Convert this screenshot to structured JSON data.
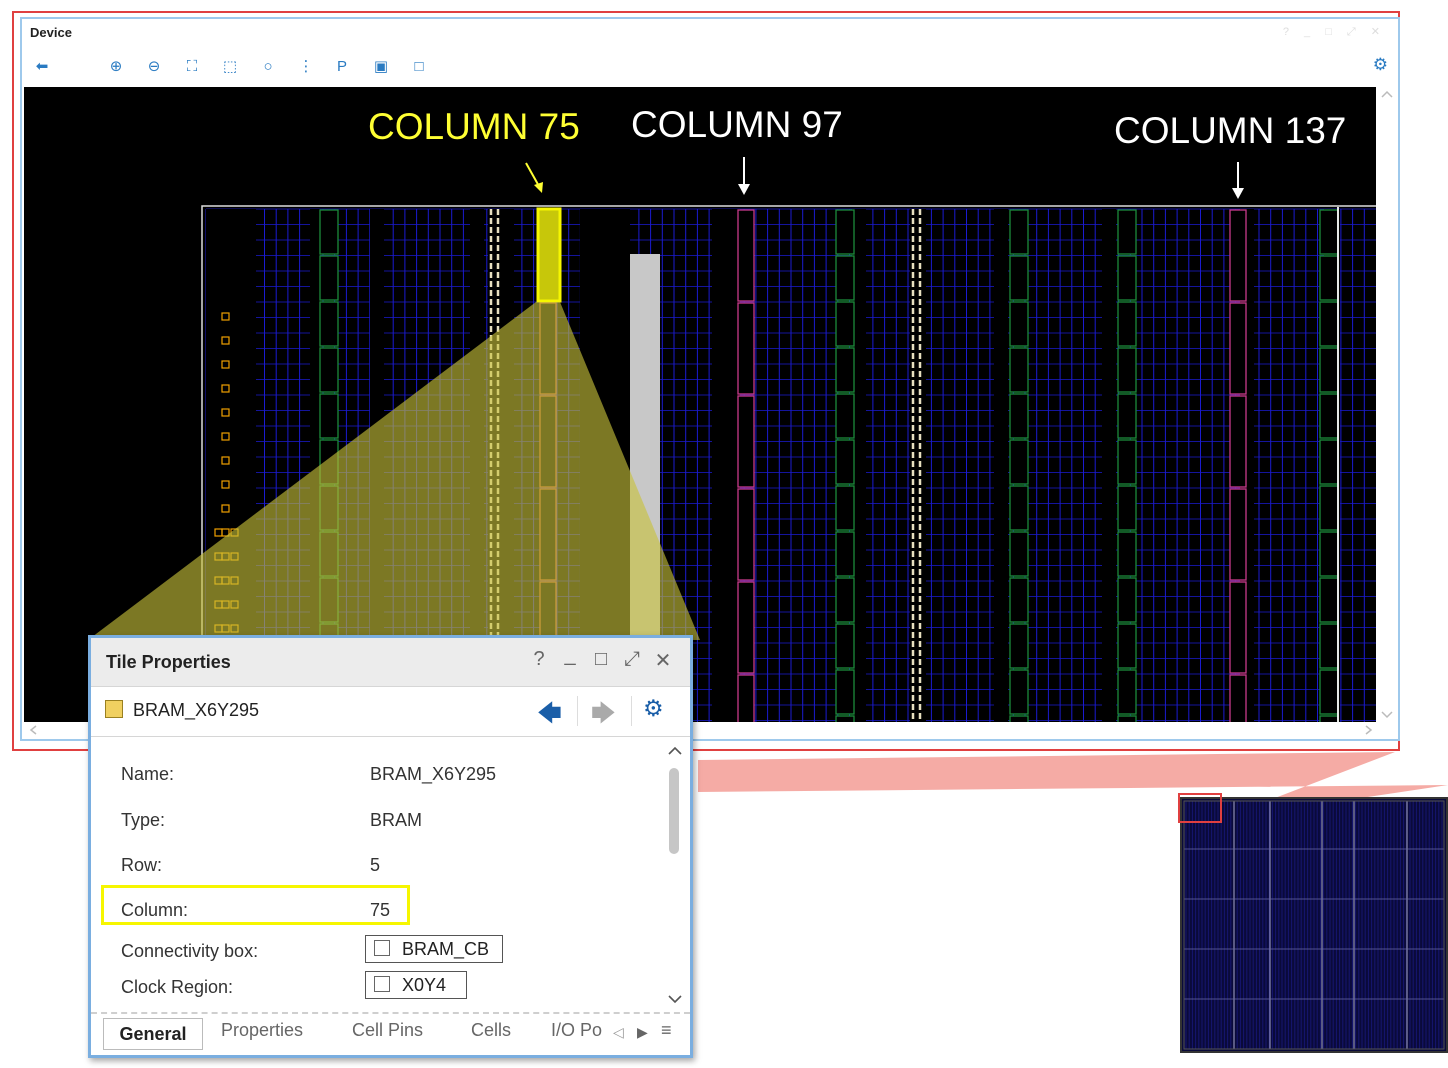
{
  "device_window": {
    "title": "Device",
    "window_controls": "? _ □ ⤢ ✕",
    "toolbar_icons": [
      "back-arrow-icon",
      "zoom-in-icon",
      "zoom-out-icon",
      "zoom-fit-icon",
      "zoom-area-icon",
      "circle-select-icon",
      "routing-icon",
      "placement-icon",
      "floorplan-icon",
      "pblock-icon"
    ],
    "settings_icon": "gear-icon"
  },
  "annotations": {
    "col75": {
      "text": "COLUMN 75",
      "color": "#ffff33"
    },
    "col97": {
      "text": "COLUMN 97",
      "color": "#ffffff"
    },
    "col137": {
      "text": "COLUMN 137",
      "color": "#ffffff"
    }
  },
  "tile_properties": {
    "title": "Tile Properties",
    "controls": {
      "help": "?",
      "minimize": "_",
      "restore": "□",
      "float": "⤢",
      "close": "✕"
    },
    "tile_name": "BRAM_X6Y295",
    "properties": [
      {
        "label": "Name:",
        "value": "BRAM_X6Y295"
      },
      {
        "label": "Type:",
        "value": "BRAM"
      },
      {
        "label": "Row:",
        "value": "5"
      },
      {
        "label": "Column:",
        "value": "75"
      }
    ],
    "connectivity_box": {
      "label": "Connectivity box:",
      "value": "BRAM_CB"
    },
    "clock_region": {
      "label": "Clock Region:",
      "value": "X0Y4"
    },
    "tabs": [
      "General",
      "Properties",
      "Cell Pins",
      "Cells",
      "I/O Po"
    ]
  },
  "colors": {
    "highlight": "#f6f600",
    "bram_col": "#c83a8a",
    "clb_grid": "#1b1bd0",
    "dsp_col": "#1c8a3a",
    "frame_red": "#e04040",
    "window_blue": "#9ec9ec"
  }
}
